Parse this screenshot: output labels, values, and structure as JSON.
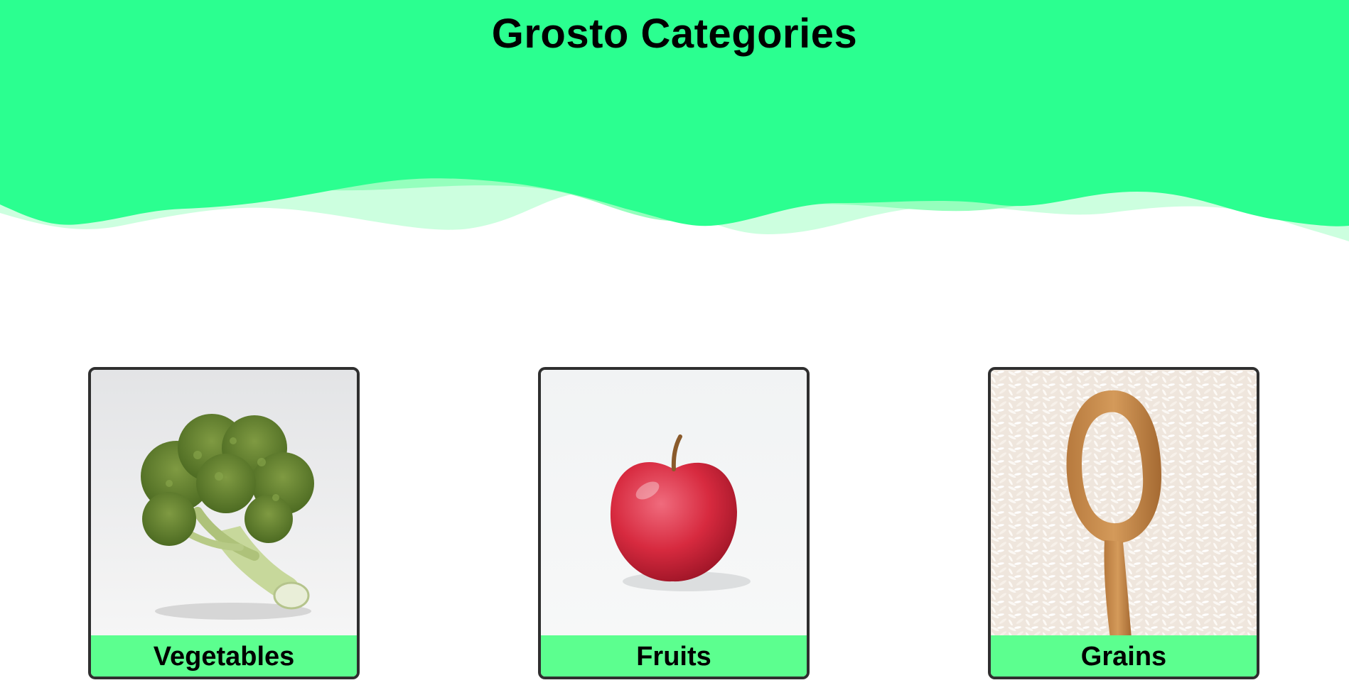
{
  "header": {
    "title": "Grosto Categories"
  },
  "colors": {
    "hero_primary": "#2bff90",
    "wave_mid": "#95ffbd",
    "wave_light": "#ccffdf",
    "label_bg": "#5cff8f",
    "card_border": "#2f2f2f"
  },
  "categories": [
    {
      "label": "Vegetables",
      "icon": "broccoli-image"
    },
    {
      "label": "Fruits",
      "icon": "apple-image"
    },
    {
      "label": "Grains",
      "icon": "rice-spoon-image"
    }
  ]
}
